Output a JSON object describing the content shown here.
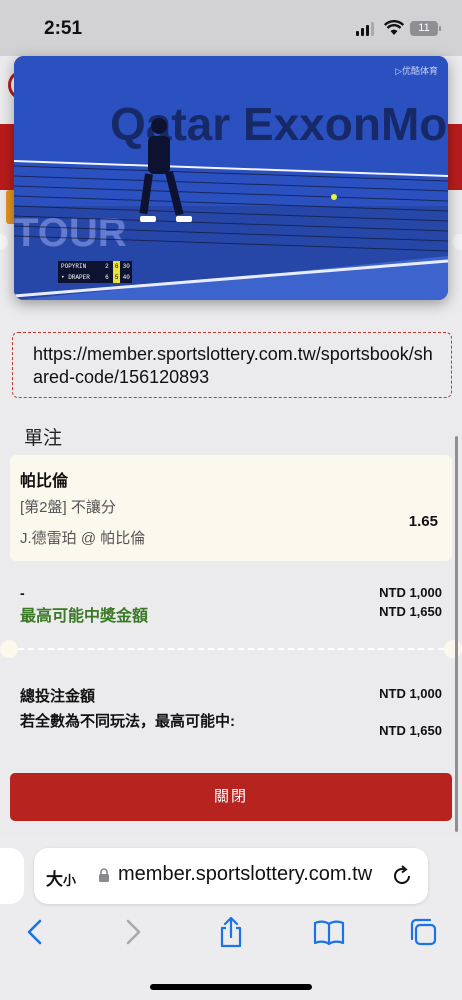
{
  "status": {
    "time": "2:51",
    "battery": "11"
  },
  "video": {
    "watermark": "▷优酷体育",
    "board": "Qatar ExxonMo",
    "tour": "TOUR",
    "score": [
      {
        "name": "POPYRIN",
        "s1": "2",
        "s2": "6",
        "pts": "30"
      },
      {
        "name": "• DRAPER",
        "s1": "6",
        "s2": "5",
        "pts": "40"
      }
    ]
  },
  "share_url": "https://member.sportslottery.com.tw/sportsbook/shared-code/156120893",
  "bet_slip": {
    "title": "單注",
    "selection": "帕比倫",
    "market": "[第2盤] 不讓分",
    "match": "J.德雷珀 @ 帕比倫",
    "odds": "1.65",
    "stake_dash": "-",
    "max_win_label": "最高可能中獎金額",
    "stake_amount": "NTD 1,000",
    "max_win_amount": "NTD 1,650",
    "total_stake_label": "總投注金額",
    "total_stake_amount": "NTD 1,000",
    "max_win_all_label": "若全數為不同玩法，最高可能中:",
    "max_win_all_amount": "NTD 1,650",
    "close_label": "關閉"
  },
  "browser": {
    "size_label": "大",
    "size_label_small": "小",
    "url": "member.sportslottery.com.tw"
  },
  "colors": {
    "accent_red": "#b7241f",
    "win_green": "#3a7a26",
    "card_bg": "#fbf8ee",
    "ios_blue": "#1a73e8"
  }
}
